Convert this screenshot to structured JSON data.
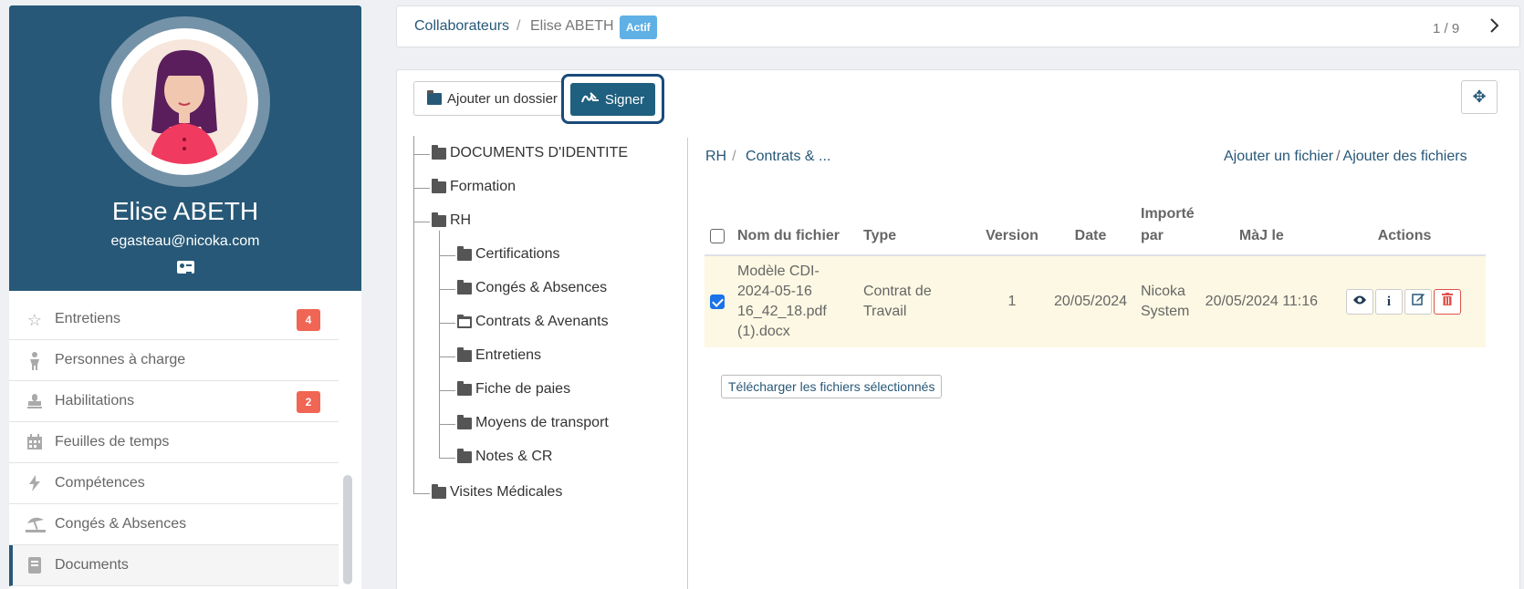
{
  "profile": {
    "name": "Elise ABETH",
    "email": "egasteau@nicoka.com"
  },
  "sidebar": {
    "items": [
      {
        "label": "Entretiens",
        "icon": "star-icon",
        "badge": "4"
      },
      {
        "label": "Personnes à charge",
        "icon": "child-icon"
      },
      {
        "label": "Habilitations",
        "icon": "stamp-icon",
        "badge": "2"
      },
      {
        "label": "Feuilles de temps",
        "icon": "calendar-icon"
      },
      {
        "label": "Compétences",
        "icon": "bolt-icon"
      },
      {
        "label": "Congés & Absences",
        "icon": "umbrella-beach-icon"
      },
      {
        "label": "Documents",
        "icon": "book-icon",
        "active": true
      }
    ]
  },
  "topbar": {
    "breadcrumb_root": "Collaborateurs",
    "breadcrumb_separator": "/",
    "breadcrumb_current": "Elise ABETH",
    "status": "Actif",
    "pager": "1 / 9"
  },
  "toolbar": {
    "add_folder_label": "Ajouter un dossier",
    "sign_label": "Signer"
  },
  "tree": {
    "nodes": [
      {
        "label": "DOCUMENTS D'IDENTITE"
      },
      {
        "label": "Formation"
      },
      {
        "label": "RH"
      },
      {
        "label": "Certifications"
      },
      {
        "label": "Congés & Absences"
      },
      {
        "label": "Contrats & Avenants",
        "open": true
      },
      {
        "label": "Entretiens"
      },
      {
        "label": "Fiche de paies"
      },
      {
        "label": "Moyens de transport"
      },
      {
        "label": "Notes & CR"
      },
      {
        "label": "Visites Médicales"
      }
    ]
  },
  "files": {
    "breadcrumb_root": "RH",
    "breadcrumb_separator": "/",
    "breadcrumb_current": "Contrats & ...",
    "add_file_label": "Ajouter un fichier",
    "add_files_label": "Ajouter des fichiers",
    "add_separator": "/",
    "columns": {
      "name": "Nom du fichier",
      "type": "Type",
      "version": "Version",
      "date": "Date",
      "imported_by": "Importé par",
      "updated": "MàJ le",
      "actions": "Actions"
    },
    "rows": [
      {
        "name": "Modèle CDI-2024-05-16 16_42_18.pdf (1).docx",
        "type": "Contrat de Travail",
        "version": "1",
        "date": "20/05/2024",
        "imported_by": "Nicoka System",
        "updated": "20/05/2024 11:16",
        "selected": true
      }
    ],
    "download_label": "Télécharger les fichiers sélectionnés"
  },
  "colors": {
    "brand": "#275877",
    "badge": "#f06553",
    "status": "#5fb0e5",
    "row_highlight": "#fcf8e3",
    "delete": "#e0524c"
  }
}
